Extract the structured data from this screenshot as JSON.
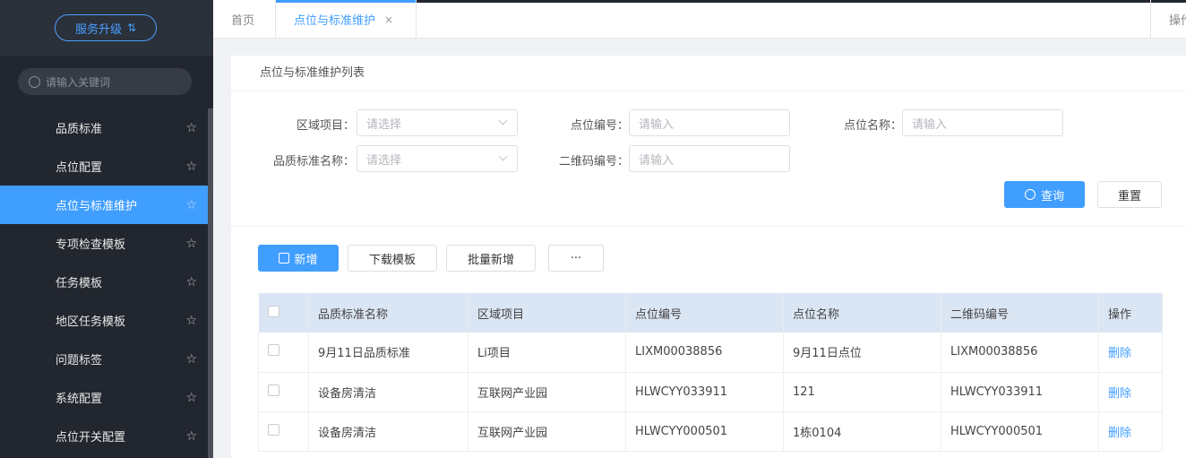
{
  "sidebar": {
    "upgrade_label": "服务升级",
    "search_placeholder": "请输入关键词",
    "items": [
      {
        "label": "品质标准"
      },
      {
        "label": "点位配置"
      },
      {
        "label": "点位与标准维护"
      },
      {
        "label": "专项检查模板"
      },
      {
        "label": "任务模板"
      },
      {
        "label": "地区任务模板"
      },
      {
        "label": "问题标签"
      },
      {
        "label": "系统配置"
      },
      {
        "label": "点位开关配置"
      }
    ],
    "active_index": 2
  },
  "tabs": {
    "home": "首页",
    "current": "点位与标准维护",
    "ops": "操作"
  },
  "panel": {
    "title": "点位与标准维护列表",
    "form": {
      "area_label": "区域项目：",
      "area_placeholder": "请选择",
      "point_no_label": "点位编号：",
      "point_no_placeholder": "请输入",
      "point_name_label": "点位名称：",
      "point_name_placeholder": "请输入",
      "standard_label": "品质标准名称：",
      "standard_placeholder": "请选择",
      "qr_label": "二维码编号：",
      "qr_placeholder": "请输入",
      "query_label": "查询",
      "reset_label": "重置"
    },
    "toolbar": {
      "add_label": "新增",
      "download_label": "下载模板",
      "batch_label": "批量新增",
      "more_label": "···"
    }
  },
  "table": {
    "headers": [
      "品质标准名称",
      "区域项目",
      "点位编号",
      "点位名称",
      "二维码编号",
      "操作"
    ],
    "rows": [
      {
        "standard": "9月11日品质标准",
        "area": "Li项目",
        "point_no": "LIXM00038856",
        "point_name": "9月11日点位",
        "qr": "LIXM00038856",
        "action": "删除"
      },
      {
        "standard": "设备房清洁",
        "area": "互联网产业园",
        "point_no": "HLWCYY033911",
        "point_name": "121",
        "qr": "HLWCYY033911",
        "action": "删除"
      },
      {
        "standard": "设备房清洁",
        "area": "互联网产业园",
        "point_no": "HLWCYY000501",
        "point_name": "1栋0104",
        "qr": "HLWCYY000501",
        "action": "删除"
      }
    ]
  }
}
